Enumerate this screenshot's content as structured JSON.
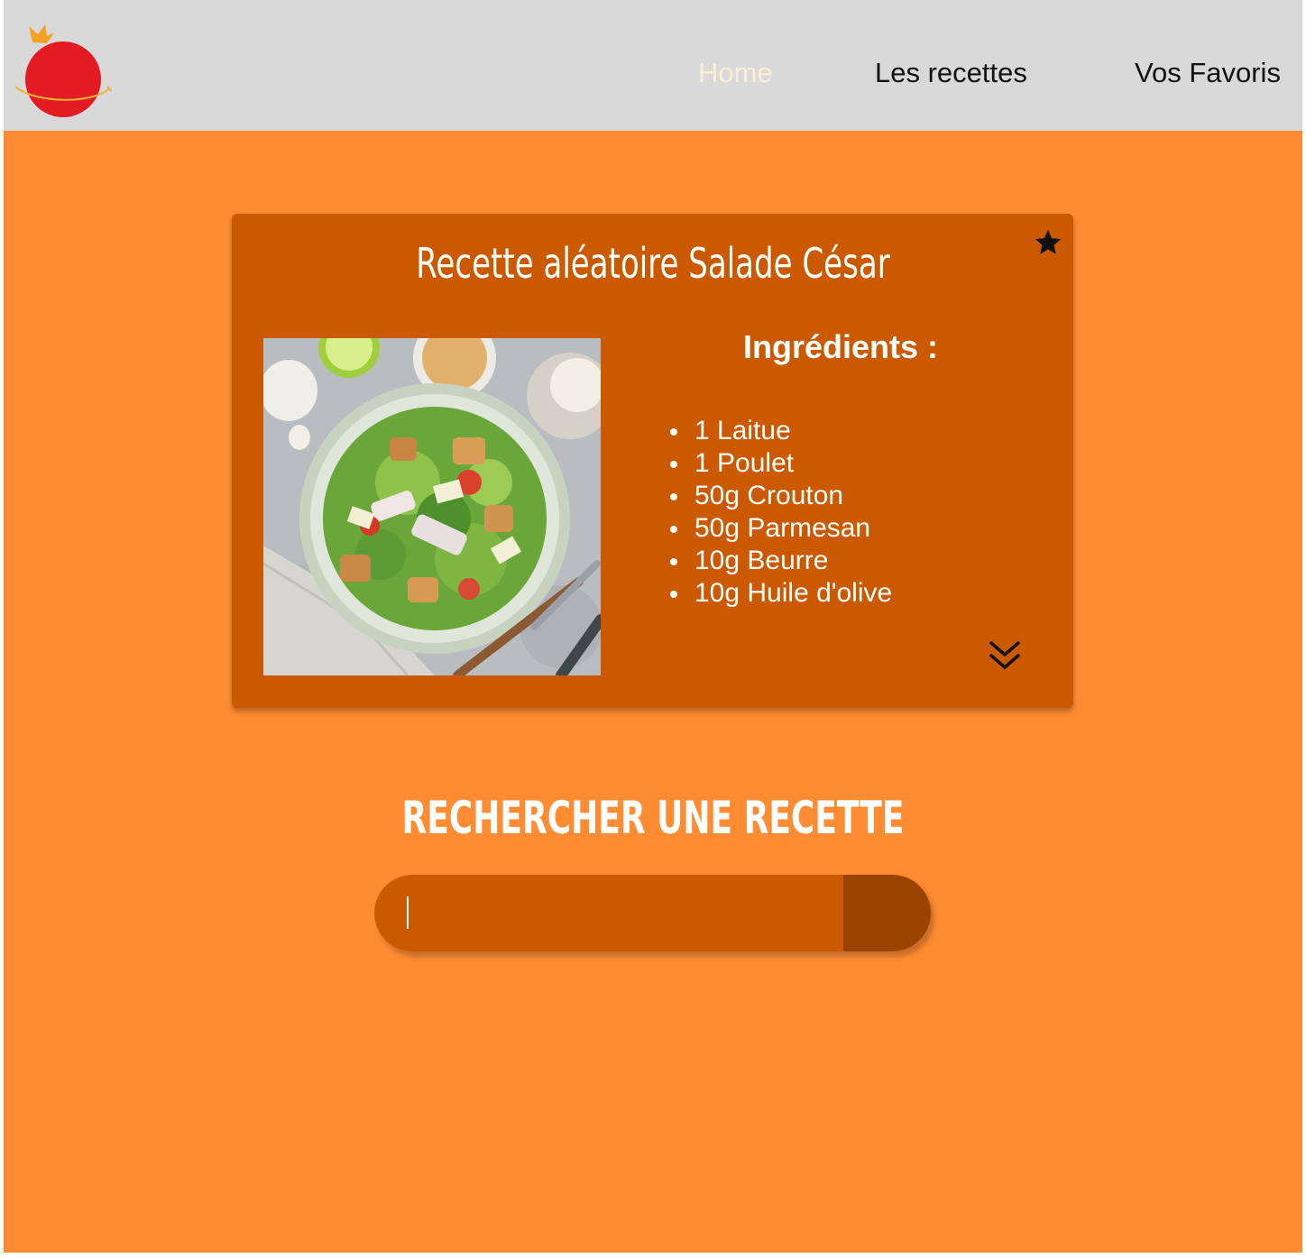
{
  "nav": {
    "home": "Home",
    "recipes": "Les recettes",
    "favorites": "Vos Favoris"
  },
  "card": {
    "title": "Recette aléatoire Salade César",
    "ingredients_heading": "Ingrédients :",
    "ingredients": [
      "1 Laitue",
      "1 Poulet",
      "50g Crouton",
      "50g Parmesan",
      "10g Beurre",
      "10g Huile d'olive"
    ]
  },
  "search": {
    "title": "RECHERCHER UNE RECETTE",
    "placeholder": "",
    "value": ""
  },
  "icons": {
    "logo": "tomato-logo",
    "favorite": "star-icon",
    "expand": "double-chevron-down-icon",
    "search_submit": "search-button"
  },
  "colors": {
    "page_background": "#ff8c33",
    "header_background": "#d9d9d9",
    "card_background": "#cb5900",
    "search_button": "#9a4400",
    "logo_red": "#e31b23",
    "active_nav": "#f6f0d8"
  }
}
